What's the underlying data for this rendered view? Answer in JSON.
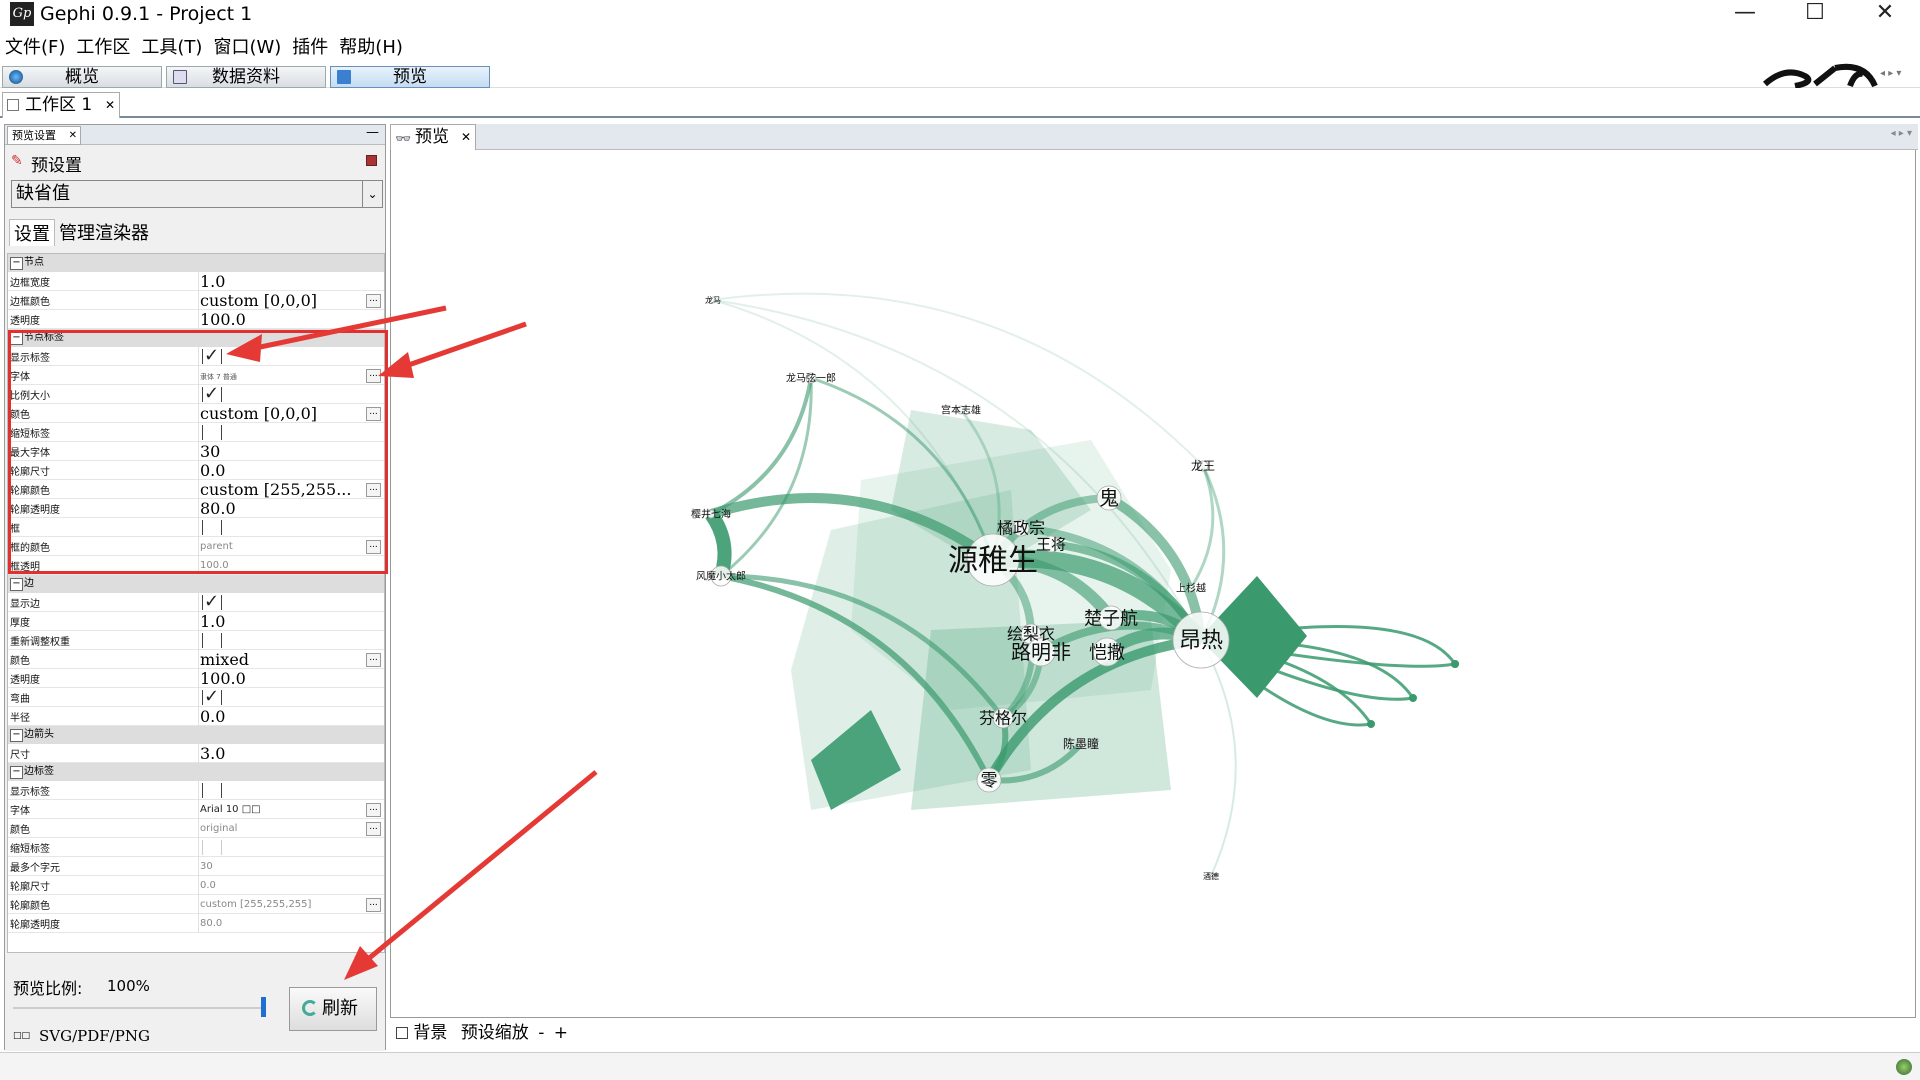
{
  "window": {
    "title": "Gephi 0.9.1 - Project 1",
    "icon_text": "Gp",
    "minimize": "—",
    "maximize": "☐",
    "close": "✕"
  },
  "menu": [
    "文件(F)",
    "工作区",
    "工具(T)",
    "窗口(W)",
    "插件",
    "帮助(H)"
  ],
  "toolbar": {
    "tabs": [
      "概览",
      "数据资料",
      "预览"
    ]
  },
  "workspace_tab": {
    "label": "工作区 1",
    "close": "✕"
  },
  "left_panel": {
    "tab_label": "预览设置",
    "tab_close": "✕",
    "minimize": "—",
    "presets_label": "预设置",
    "preset_value": "缺省值",
    "subtabs": [
      "设置",
      "管理渲染器"
    ],
    "sections": {
      "nodes": "节点",
      "node_labels": "节点标签",
      "edges": "边",
      "edge_arrows": "边箭头",
      "edge_labels": "边标签"
    },
    "rows": {
      "node_border_width": {
        "key": "边框宽度",
        "value": "1.0"
      },
      "node_border_color": {
        "key": "边框颜色",
        "value": "custom [0,0,0]"
      },
      "node_opacity": {
        "key": "透明度",
        "value": "100.0"
      },
      "nl_show": {
        "key": "显示标签",
        "checked": true
      },
      "nl_font": {
        "key": "字体",
        "value": "隶体 7 普通"
      },
      "nl_proportional": {
        "key": "比例大小",
        "checked": true
      },
      "nl_color": {
        "key": "颜色",
        "value": "custom [0,0,0]"
      },
      "nl_shorten": {
        "key": "缩短标签",
        "checked": false
      },
      "nl_max_chars": {
        "key": "最大字体",
        "value": "30"
      },
      "nl_outline_size": {
        "key": "轮廓尺寸",
        "value": "0.0"
      },
      "nl_outline_color": {
        "key": "轮廓颜色",
        "value": "custom [255,255..."
      },
      "nl_outline_opacity": {
        "key": "轮廓透明度",
        "value": "80.0"
      },
      "nl_box": {
        "key": "框",
        "checked": false
      },
      "nl_box_color": {
        "key": "框的颜色",
        "value": "parent"
      },
      "nl_box_opacity": {
        "key": "框透明",
        "value": "100.0"
      },
      "e_show": {
        "key": "显示边",
        "checked": true
      },
      "e_thickness": {
        "key": "厚度",
        "value": "1.0"
      },
      "e_rescale": {
        "key": "重新调整权重",
        "checked": false
      },
      "e_color": {
        "key": "颜色",
        "value": "mixed"
      },
      "e_opacity": {
        "key": "透明度",
        "value": "100.0"
      },
      "e_curved": {
        "key": "弯曲",
        "checked": true
      },
      "e_radius": {
        "key": "半径",
        "value": "0.0"
      },
      "ea_size": {
        "key": "尺寸",
        "value": "3.0"
      },
      "el_show": {
        "key": "显示标签",
        "checked": false
      },
      "el_font": {
        "key": "字体",
        "value": "Arial 10 □□"
      },
      "el_color": {
        "key": "颜色",
        "value": "original"
      },
      "el_shorten": {
        "key": "缩短标签",
        "checked": false
      },
      "el_max_chars": {
        "key": "最多个字元",
        "value": "30"
      },
      "el_outline_size": {
        "key": "轮廓尺寸",
        "value": "0.0"
      },
      "el_outline_color": {
        "key": "轮廓颜色",
        "value": "custom [255,255,255]"
      },
      "el_outline_opacity": {
        "key": "轮廓透明度",
        "value": "80.0"
      }
    },
    "dots": "...",
    "scale_label": "预览比例:",
    "scale_value": "100%",
    "scale_fraction": 1.0,
    "refresh_label": "刷新",
    "export_label": "SVG/PDF/PNG"
  },
  "right_panel": {
    "tab_label": "预览",
    "tab_close": "✕",
    "background_label": "背景",
    "zoom_label": "预设缩放",
    "zoom_minus": "-",
    "zoom_plus": "+"
  },
  "graph": {
    "accent": "#3a9a6e",
    "labels": [
      "龙马",
      "龙马弦一郎",
      "宫本志雄",
      "龙王",
      "鬼",
      "橘政宗",
      "王将",
      "源稚生",
      "樱井七海",
      "风魔小太郎",
      "上杉越",
      "绘梨衣",
      "楚子航",
      "路明非",
      "恺撒",
      "昂热",
      "芬格尔",
      "陈墨瞳",
      "零",
      "酒德"
    ]
  },
  "colors": {
    "annotation_red": "#e53935",
    "node_green": "#3a9a6e"
  }
}
